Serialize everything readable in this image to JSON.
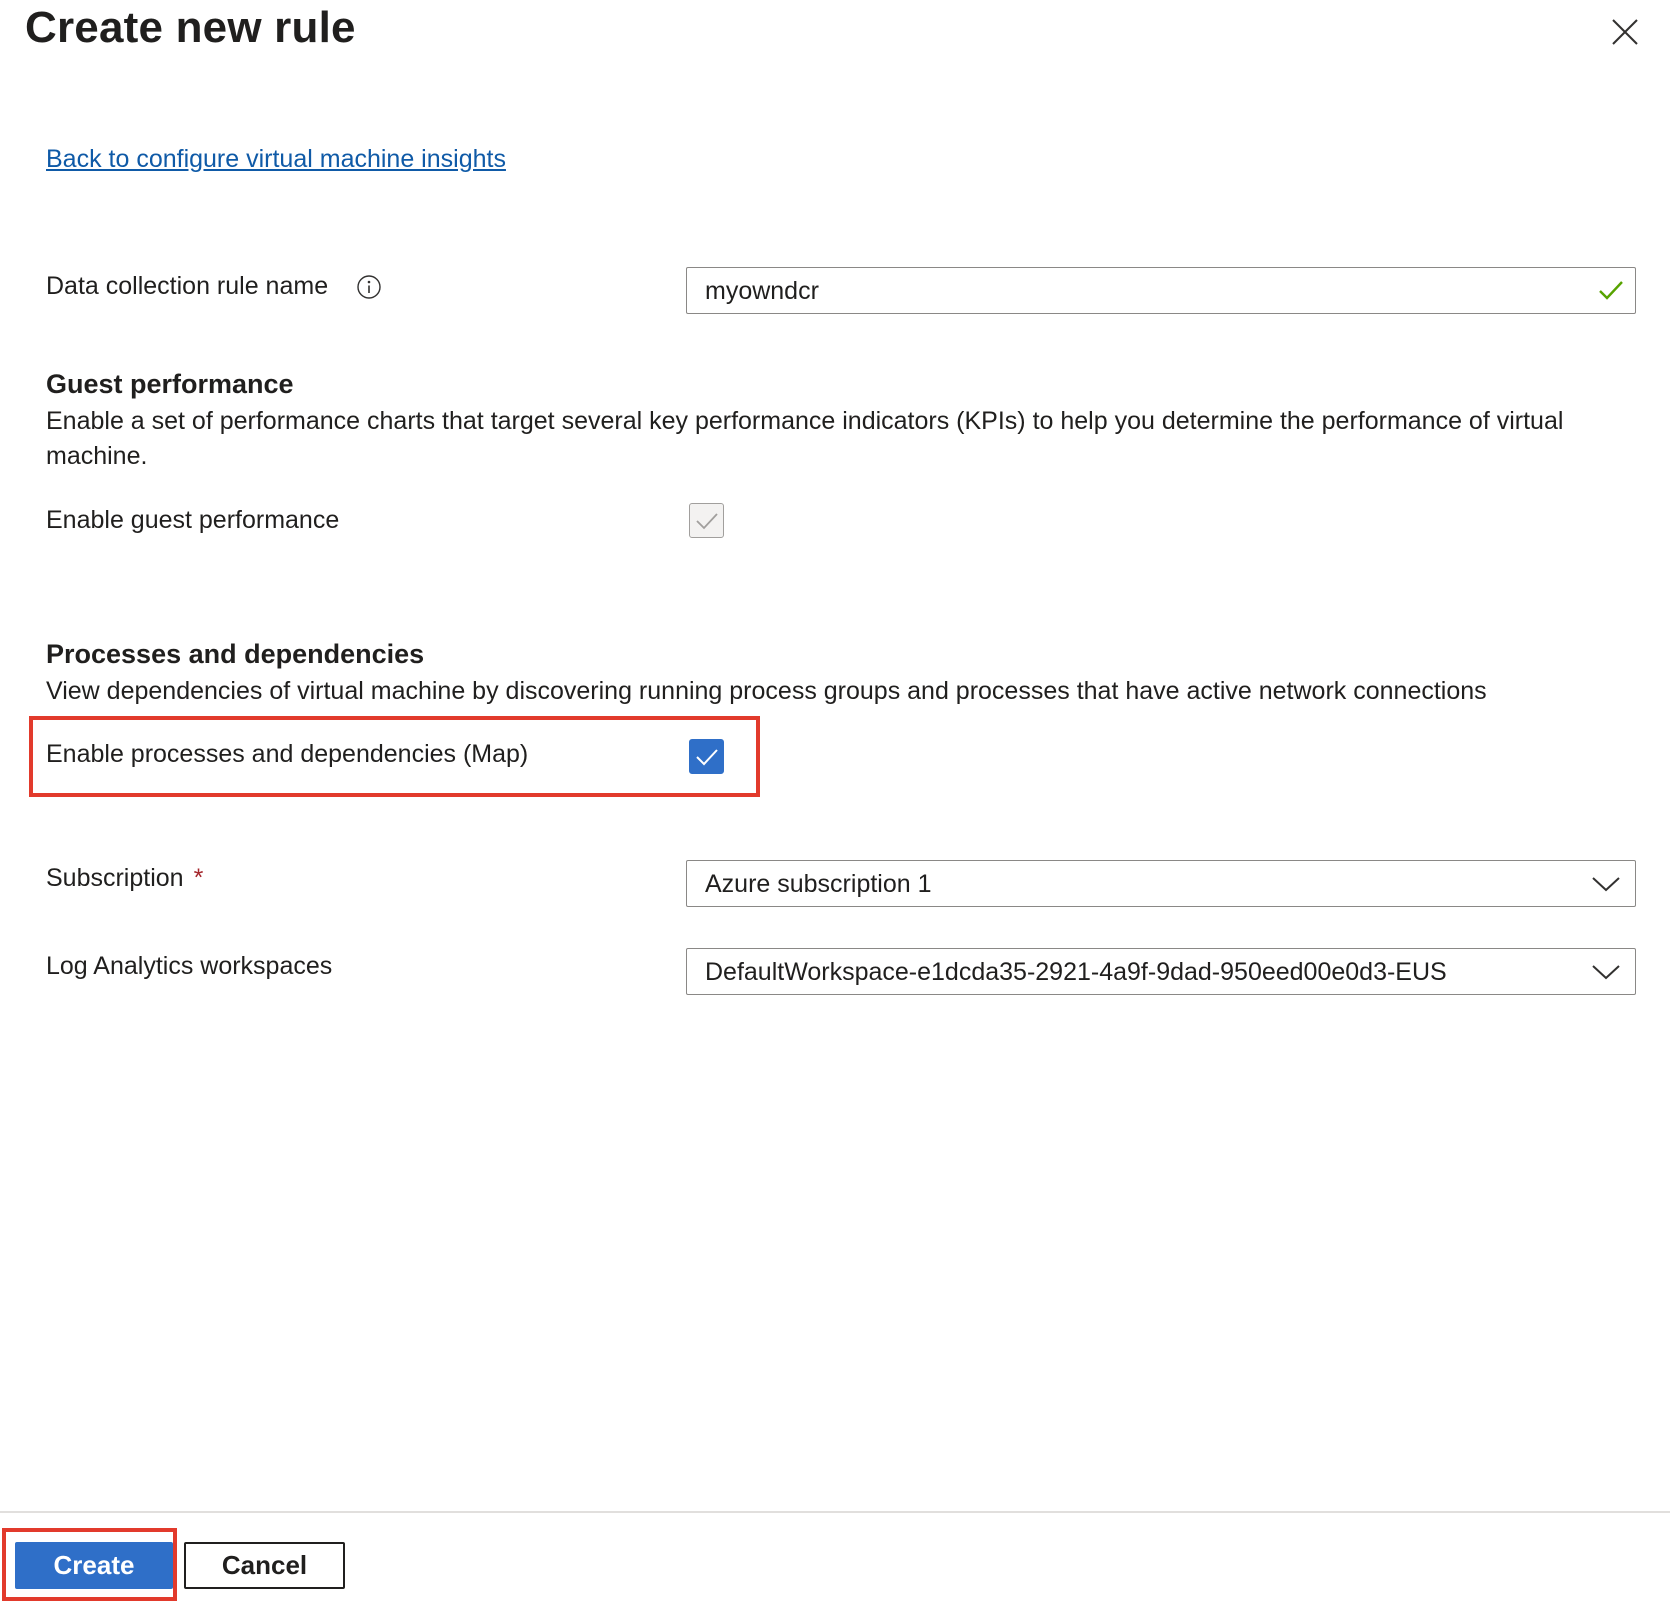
{
  "panel": {
    "title": "Create new rule",
    "back_link": "Back to configure virtual machine insights"
  },
  "icons": {
    "close": "close-icon",
    "info": "info-icon",
    "valid": "checkmark-icon",
    "dropdown": "chevron-down-icon"
  },
  "form": {
    "dcr_name": {
      "label": "Data collection rule name",
      "value": "myowndcr",
      "valid": true
    },
    "guest_performance": {
      "title": "Guest performance",
      "description": "Enable a set of performance charts that target several key performance indicators (KPIs) to help you determine the performance of virtual machine.",
      "checkbox_label": "Enable guest performance",
      "checked": true,
      "disabled": true
    },
    "processes": {
      "title": "Processes and dependencies",
      "description": "View dependencies of virtual machine by discovering running process groups and processes that have active network connections",
      "checkbox_label": "Enable processes and dependencies (Map)",
      "checked": true
    },
    "subscription": {
      "label": "Subscription",
      "required_marker": "*",
      "value": "Azure subscription 1"
    },
    "workspace": {
      "label": "Log Analytics workspaces",
      "value": "DefaultWorkspace-e1dcda35-2921-4a9f-9dad-950eed00e0d3-EUS"
    }
  },
  "footer": {
    "create_label": "Create",
    "cancel_label": "Cancel"
  },
  "colors": {
    "accent": "#2f6fc8",
    "link": "#0f5aa7",
    "highlight": "#e23a2c",
    "valid": "#57a300",
    "required": "#a4262c"
  }
}
